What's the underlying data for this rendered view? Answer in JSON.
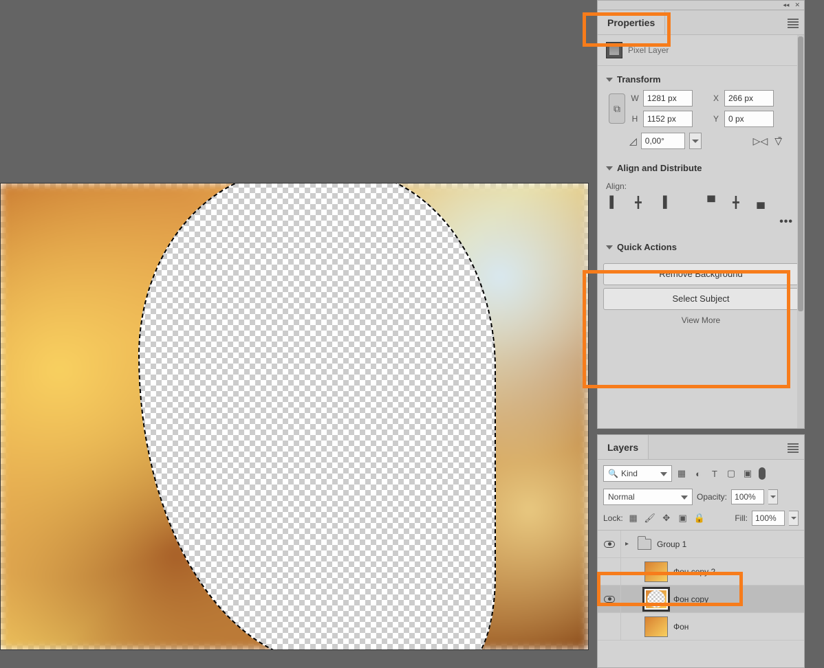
{
  "panels": {
    "properties": {
      "tab": "Properties",
      "layer_type": "Pixel Layer",
      "transform": {
        "title": "Transform",
        "w_label": "W",
        "w": "1281 px",
        "h_label": "H",
        "h": "1152 px",
        "x_label": "X",
        "x": "266 px",
        "y_label": "Y",
        "y": "0 px",
        "angle": "0,00°"
      },
      "align": {
        "title": "Align and Distribute",
        "label": "Align:"
      },
      "quick": {
        "title": "Quick Actions",
        "remove_bg": "Remove Background",
        "select_subject": "Select Subject",
        "view_more": "View More"
      }
    },
    "layers": {
      "tab": "Layers",
      "kind": "Kind",
      "blend_mode": "Normal",
      "opacity_label": "Opacity:",
      "opacity": "100%",
      "lock_label": "Lock:",
      "fill_label": "Fill:",
      "fill": "100%",
      "items": [
        {
          "name": "Group 1",
          "type": "group",
          "visible": true
        },
        {
          "name": "Фон copy 2",
          "type": "pixel",
          "visible": false
        },
        {
          "name": "Фон copy",
          "type": "pixel",
          "visible": true,
          "selected": true
        },
        {
          "name": "Фон",
          "type": "pixel",
          "visible": false
        }
      ]
    }
  }
}
